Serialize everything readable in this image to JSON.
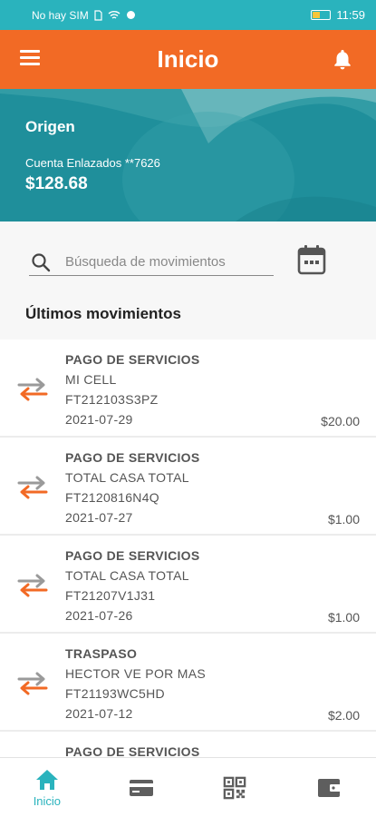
{
  "status_bar": {
    "carrier": "No hay SIM",
    "time": "11:59"
  },
  "header": {
    "title": "Inicio"
  },
  "account": {
    "title": "Origen",
    "label": "Cuenta Enlazados **7626",
    "balance": "$128.68"
  },
  "search": {
    "placeholder": "Búsqueda de movimientos"
  },
  "section": {
    "title": "Últimos movimientos"
  },
  "transactions": [
    {
      "type": "PAGO DE SERVICIOS",
      "name": "MI CELL",
      "ref": "FT212103S3PZ",
      "date": "2021-07-29",
      "amount": "$20.00"
    },
    {
      "type": "PAGO DE SERVICIOS",
      "name": "TOTAL CASA TOTAL",
      "ref": "FT2120816N4Q",
      "date": "2021-07-27",
      "amount": "$1.00"
    },
    {
      "type": "PAGO DE SERVICIOS",
      "name": "TOTAL CASA TOTAL",
      "ref": "FT21207V1J31",
      "date": "2021-07-26",
      "amount": "$1.00"
    },
    {
      "type": "TRASPASO",
      "name": "HECTOR VE POR MAS",
      "ref": "FT21193WC5HD",
      "date": "2021-07-12",
      "amount": "$2.00"
    },
    {
      "type": "PAGO DE SERVICIOS",
      "name": "",
      "ref": "",
      "date": "",
      "amount": ""
    }
  ],
  "nav": {
    "home_label": "Inicio"
  },
  "colors": {
    "primary": "#f26a25",
    "accent": "#2ab3bd",
    "hero": "#1f8f9b"
  },
  "icons": [
    "menu-icon",
    "bell-icon",
    "search-icon",
    "calendar-icon",
    "transfer-icon",
    "home-icon",
    "card-icon",
    "qr-icon",
    "wallet-icon"
  ]
}
